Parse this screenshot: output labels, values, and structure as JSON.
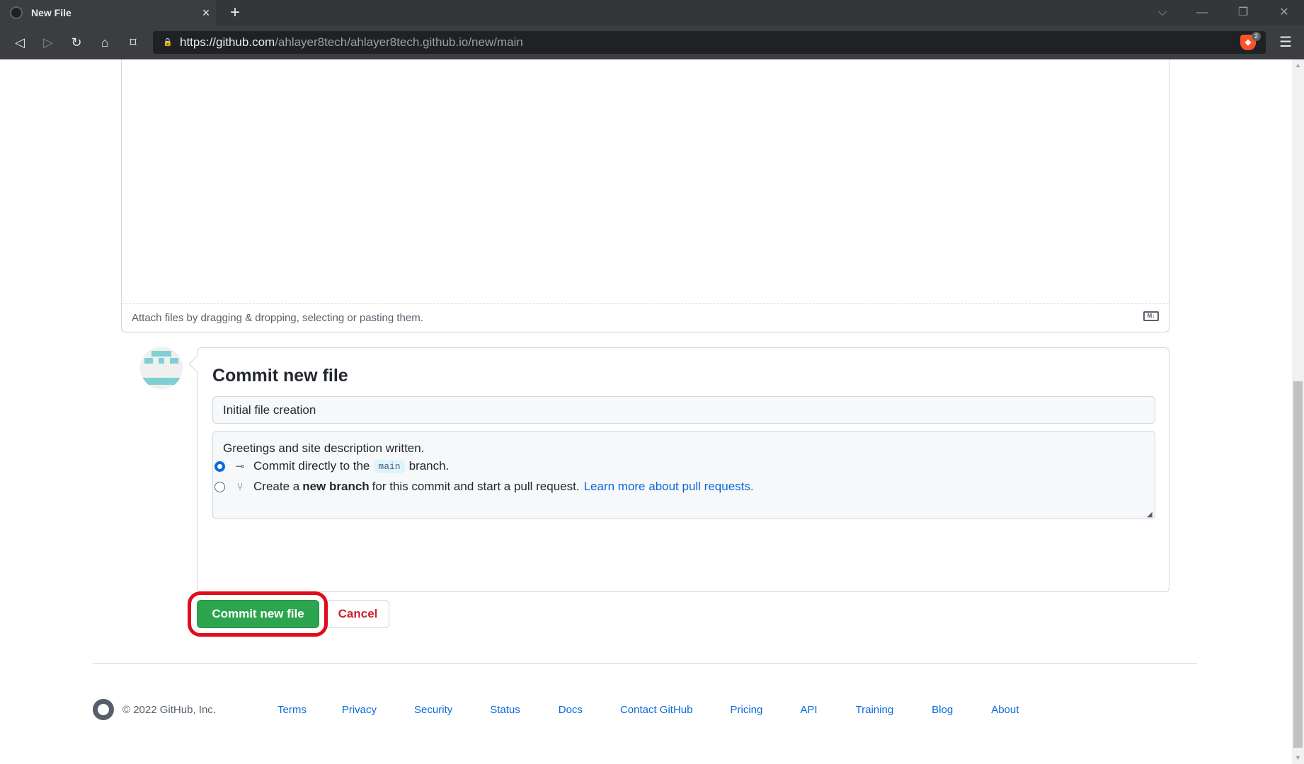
{
  "browser": {
    "tab_title": "New File",
    "tab_close": "×",
    "new_tab": "+",
    "url_host": "https://github.com",
    "url_path": "/ahlayer8tech/ahlayer8tech.github.io/new/main",
    "shield_count": "2"
  },
  "editor": {
    "attach_text": "Attach files by dragging & dropping, selecting or pasting them.",
    "markdown_icon_label": "M↓"
  },
  "commit": {
    "title": "Commit new file",
    "summary_value": "Initial file creation",
    "description_value": "Greetings and site description written.",
    "option_direct": {
      "prefix": "Commit directly to the",
      "branch": "main",
      "suffix": "branch."
    },
    "option_new_branch": {
      "prefix": "Create a",
      "bold": "new branch",
      "suffix": "for this commit and start a pull request.",
      "link": "Learn more about pull requests."
    },
    "submit_label": "Commit new file",
    "cancel_label": "Cancel"
  },
  "footer": {
    "copyright": "© 2022 GitHub, Inc.",
    "links": [
      "Terms",
      "Privacy",
      "Security",
      "Status",
      "Docs",
      "Contact GitHub",
      "Pricing",
      "API",
      "Training",
      "Blog",
      "About"
    ]
  },
  "colors": {
    "primary_button": "#2da44e",
    "cancel_text": "#cf222e",
    "link": "#0969da",
    "annotation": "#e00b1c"
  }
}
